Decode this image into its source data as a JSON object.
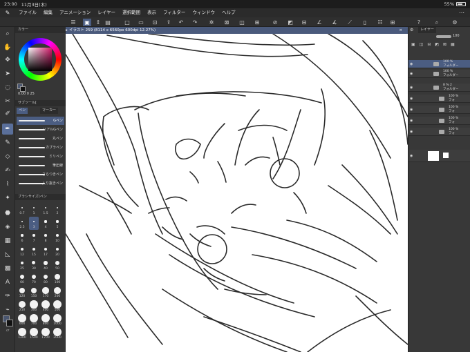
{
  "status": {
    "time": "23:00",
    "date": "11月3日(木)",
    "battery": "55%"
  },
  "menu": [
    "ファイル",
    "編集",
    "アニメーション",
    "レイヤー",
    "選択範囲",
    "表示",
    "フィルター",
    "ウィンドウ",
    "ヘルプ"
  ],
  "canvas": {
    "tab_title": "イラスト 259 (8114 x 6560px 600dpi 12.27%)",
    "close": "×"
  },
  "left_panel": {
    "color_tab": "カラー",
    "color_value": "0.00  0  25",
    "sub_tool_tab": "サブツール[",
    "sub_tabs": [
      "ペン",
      "マーカー"
    ],
    "brushes": [
      {
        "label": "Gペン"
      },
      {
        "label": "リアルGペン"
      },
      {
        "label": "丸ペン"
      },
      {
        "label": "カブラペン"
      },
      {
        "label": "ミリペン"
      },
      {
        "label": "筆圧線"
      },
      {
        "label": "さらつきペン"
      },
      {
        "label": "入り抜きペン"
      }
    ],
    "brush_size_tab": "ブラシサイズ(ペン",
    "brush_sizes": [
      "0.7",
      "1",
      "1.5",
      "2",
      "2.5",
      "3",
      "4",
      "5",
      "6",
      "7",
      "8",
      "10",
      "12",
      "15",
      "17",
      "20",
      "25",
      "30",
      "40",
      "50",
      "60",
      "70",
      "80",
      "100",
      "120",
      "150",
      "170",
      "200",
      "250",
      "300",
      "400",
      "500",
      "600",
      "700",
      "800",
      "1000",
      "1200",
      "1500",
      "1700",
      "2000"
    ]
  },
  "right_panel": {
    "layer_tab": "レイヤー",
    "opacity": "100",
    "layers": [
      {
        "opacity": "100 %",
        "name": "フォルダー"
      },
      {
        "opacity": "100 %",
        "name": "フォルダー"
      },
      {
        "opacity": "8 % 2",
        "name": "フォルダー"
      },
      {
        "opacity": "100 %",
        "name": "フォ"
      },
      {
        "opacity": "100 %",
        "name": "フォ"
      },
      {
        "opacity": "100 %",
        "name": "フォ"
      },
      {
        "opacity": "100 %",
        "name": "フォ"
      }
    ]
  }
}
